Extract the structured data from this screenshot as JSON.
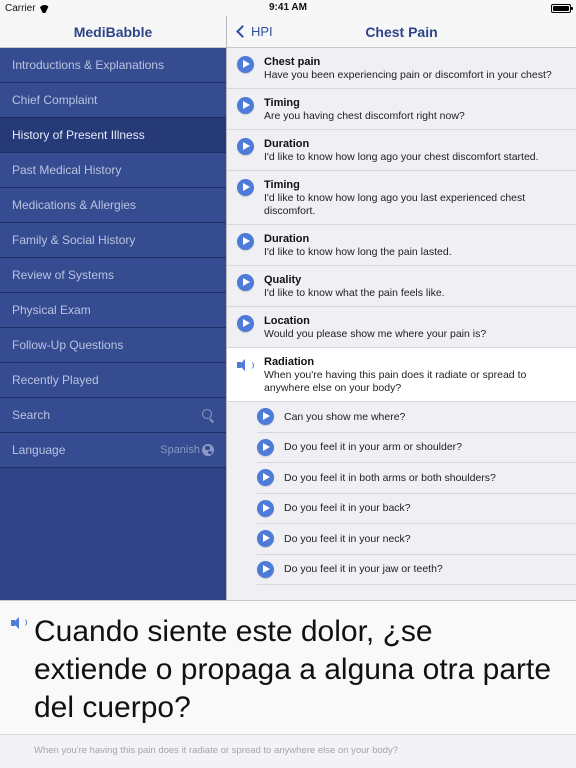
{
  "status_bar": {
    "carrier": "Carrier",
    "time": "9:41 AM"
  },
  "sidebar": {
    "title": "MediBabble",
    "items": [
      {
        "label": "Introductions & Explanations"
      },
      {
        "label": "Chief Complaint"
      },
      {
        "label": "History of Present Illness",
        "active": true
      },
      {
        "label": "Past Medical History"
      },
      {
        "label": "Medications & Allergies"
      },
      {
        "label": "Family & Social History"
      },
      {
        "label": "Review of Systems"
      },
      {
        "label": "Physical Exam"
      },
      {
        "label": "Follow-Up Questions"
      },
      {
        "label": "Recently Played"
      },
      {
        "label": "Search",
        "icon": "search-icon"
      },
      {
        "label": "Language",
        "value": "Spanish",
        "icon": "globe-icon"
      }
    ]
  },
  "main": {
    "back_label": "HPI",
    "title": "Chest Pain",
    "questions": [
      {
        "title": "Chest pain",
        "body": "Have you been experiencing pain or discomfort in your chest?"
      },
      {
        "title": "Timing",
        "body": "Are you having chest discomfort right now?"
      },
      {
        "title": "Duration",
        "body": "I'd like to know how long ago your chest discomfort started."
      },
      {
        "title": "Timing",
        "body": "I'd like to know how long ago you last experienced chest discomfort."
      },
      {
        "title": "Duration",
        "body": "I'd like to know how long the pain lasted."
      },
      {
        "title": "Quality",
        "body": "I'd like to know what the pain feels like."
      },
      {
        "title": "Location",
        "body": "Would you please show me where your pain is?"
      },
      {
        "title": "Radiation",
        "body": "When you're having this pain does it radiate or spread to anywhere else on your body?"
      }
    ],
    "sub_questions": [
      "Can you show me where?",
      "Do you feel it in your arm or shoulder?",
      "Do you feel it in both arms or both shoulders?",
      "Do you feel it in your back?",
      "Do you feel it in your neck?",
      "Do you feel it in your jaw or teeth?"
    ]
  },
  "translation": {
    "text": "Cuando siente este dolor, ¿se extiende o propaga a alguna otra parte del cuerpo?",
    "source": "When you're having this pain does it radiate or spread to anywhere else on your body?"
  },
  "colors": {
    "sidebar_bg": "#364c90",
    "accent": "#4e7bd8",
    "title": "#2f4487"
  }
}
